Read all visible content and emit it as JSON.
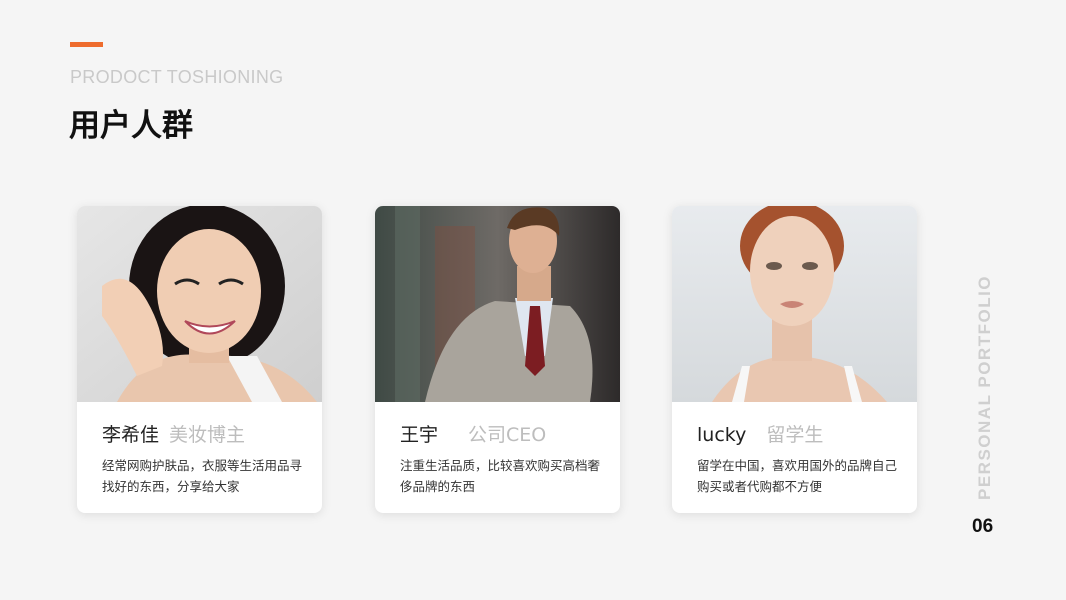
{
  "header": {
    "subtitle": "PRODOCT TOSHIONING",
    "title": "用户人群",
    "accent_color": "#ee6c2d"
  },
  "cards": [
    {
      "name": "李希佳",
      "role": "美妆博主",
      "desc": "经常网购护肤品，衣服等生活用品寻找好的东西，分享给大家",
      "photo": "smiling-woman-portrait"
    },
    {
      "name": "王宇",
      "role": "公司CEO",
      "desc": "注重生活品质，比较喜欢购买高档奢侈品牌的东西",
      "photo": "man-in-suit-portrait"
    },
    {
      "name": "lucky",
      "role": "留学生",
      "desc": "留学在中国，喜欢用国外的品牌自己购买或者代购都不方便",
      "photo": "red-haired-woman-portrait"
    }
  ],
  "side": {
    "vertical_label": "PERSONAL PORTFOLIO",
    "page_number": "06"
  }
}
